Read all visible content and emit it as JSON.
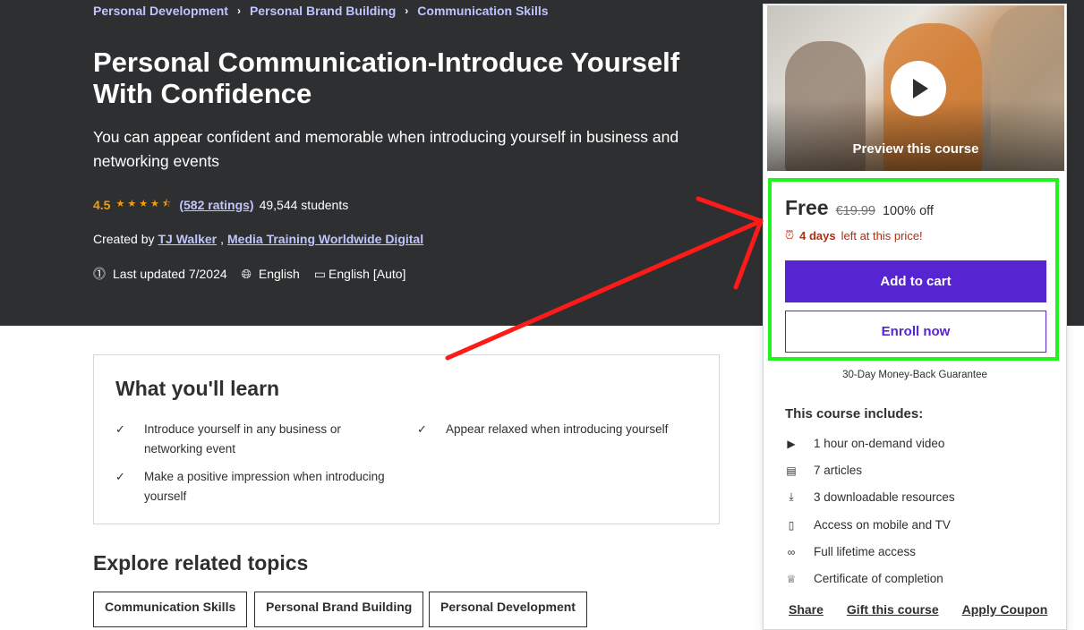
{
  "breadcrumb": [
    "Personal Development",
    "Personal Brand Building",
    "Communication Skills"
  ],
  "course": {
    "title": "Personal Communication-Introduce Yourself With Confidence",
    "subtitle": "You can appear confident and memorable when introducing yourself in business and networking events",
    "rating": "4.5",
    "stars": "★★★★⯪",
    "ratings_link": "(582 ratings)",
    "students": "49,544 students",
    "created_by": "Created by",
    "authors": [
      "TJ Walker",
      "Media Training Worldwide Digital"
    ],
    "last_updated": "Last updated 7/2024",
    "language": "English",
    "captions": "English [Auto]"
  },
  "learn": {
    "title": "What you'll learn",
    "items": [
      "Introduce yourself in any business or networking event",
      "Appear relaxed when introducing yourself",
      "Make a positive impression when introducing yourself"
    ]
  },
  "explore": {
    "title": "Explore related topics",
    "topics": [
      "Communication Skills",
      "Personal Brand Building",
      "Personal Development"
    ]
  },
  "sidebar": {
    "preview_label": "Preview this course",
    "price": "Free",
    "original_price": "€19.99",
    "discount": "100% off",
    "timer_bold": "4 days",
    "timer_rest": "left at this price!",
    "add_to_cart": "Add to cart",
    "enroll": "Enroll now",
    "guarantee": "30-Day Money-Back Guarantee",
    "includes_title": "This course includes:",
    "includes": [
      {
        "icon": "video-icon",
        "text": "1 hour on-demand video"
      },
      {
        "icon": "article-icon",
        "text": "7 articles"
      },
      {
        "icon": "download-icon",
        "text": "3 downloadable resources"
      },
      {
        "icon": "mobile-icon",
        "text": "Access on mobile and TV"
      },
      {
        "icon": "infinity-icon",
        "text": "Full lifetime access"
      },
      {
        "icon": "trophy-icon",
        "text": "Certificate of completion"
      }
    ],
    "footer": [
      "Share",
      "Gift this course",
      "Apply Coupon"
    ]
  },
  "colors": {
    "hero_bg": "#2d2f31",
    "accent": "#5624d0",
    "link": "#c0c4fc",
    "star": "#f69c08",
    "annotation_box": "#21f321",
    "annotation_arrow": "#ff1a1a"
  }
}
